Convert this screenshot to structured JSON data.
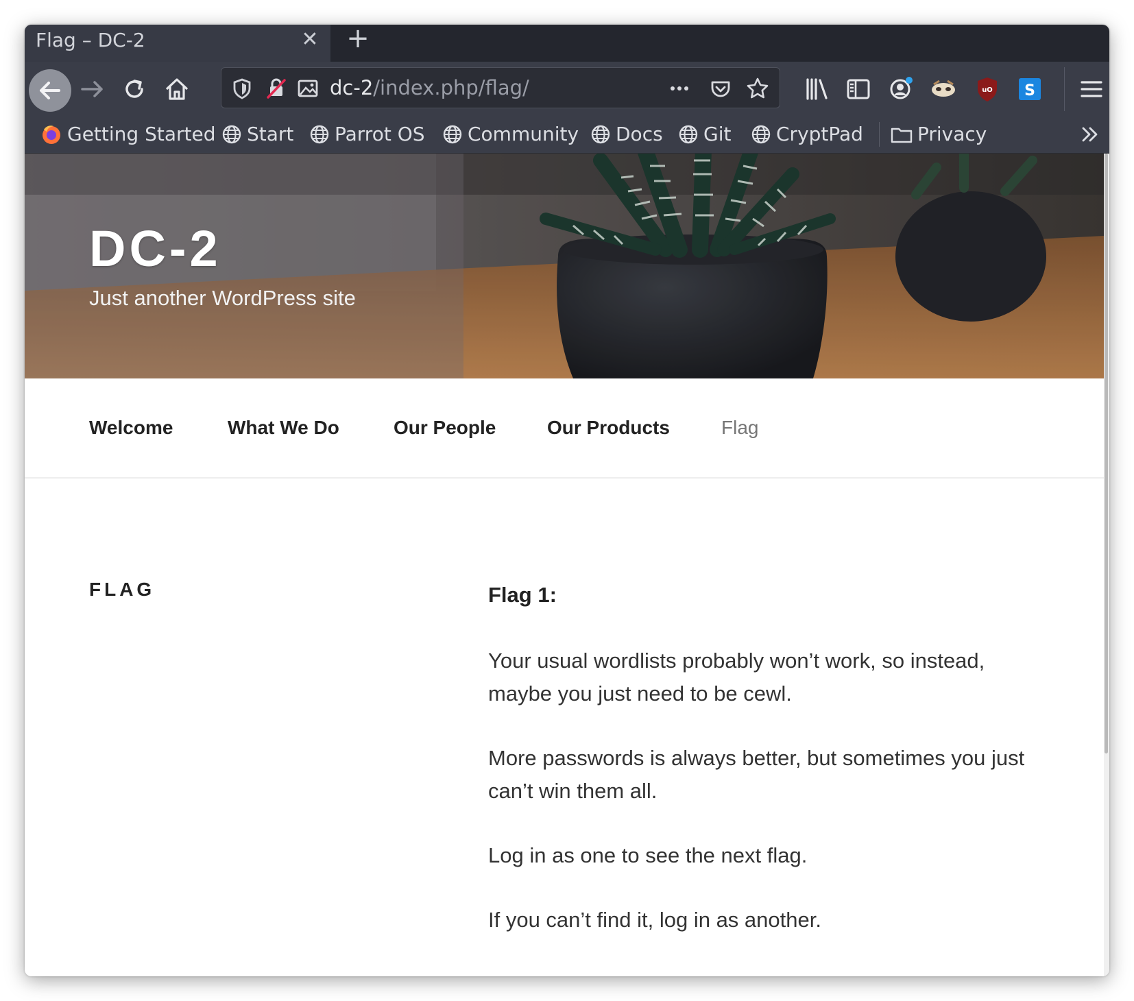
{
  "browser": {
    "tab_title": "Flag – DC-2",
    "url_host": "dc-2",
    "url_path": "/index.php/flag/",
    "bookmarks": [
      "Getting Started",
      "Start",
      "Parrot OS",
      "Community",
      "Docs",
      "Git",
      "CryptPad",
      "Privacy"
    ]
  },
  "site": {
    "title": "DC-2",
    "description": "Just another WordPress site",
    "menu": [
      "Welcome",
      "What We Do",
      "Our People",
      "Our Products",
      "Flag"
    ],
    "current_menu": "Flag"
  },
  "post": {
    "title": "FLAG",
    "lead": "Flag 1:",
    "paragraphs": [
      "Your usual wordlists probably won’t work, so instead, maybe you just need to be cewl.",
      "More passwords is always better, but sometimes you just can’t win them all.",
      "Log in as one to see the next flag.",
      "If you can’t find it, log in as another."
    ]
  },
  "colors": {
    "toolbar": "#3a3d48",
    "tabstrip": "#24262e",
    "text": "#333333",
    "menu_current": "#767676"
  }
}
